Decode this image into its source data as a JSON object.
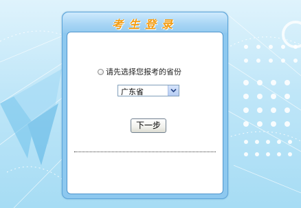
{
  "login": {
    "title": "考生登录",
    "prompt": "请先选择您报考的省份",
    "province": {
      "selected": "广东省"
    },
    "next_label": "下一步"
  },
  "icons": {
    "radio": "radio-icon",
    "dropdown": "chevron-down-icon"
  },
  "colors": {
    "title": "#f39c12",
    "panel_border": "#4f95cc",
    "background": "#bfe6f8"
  }
}
